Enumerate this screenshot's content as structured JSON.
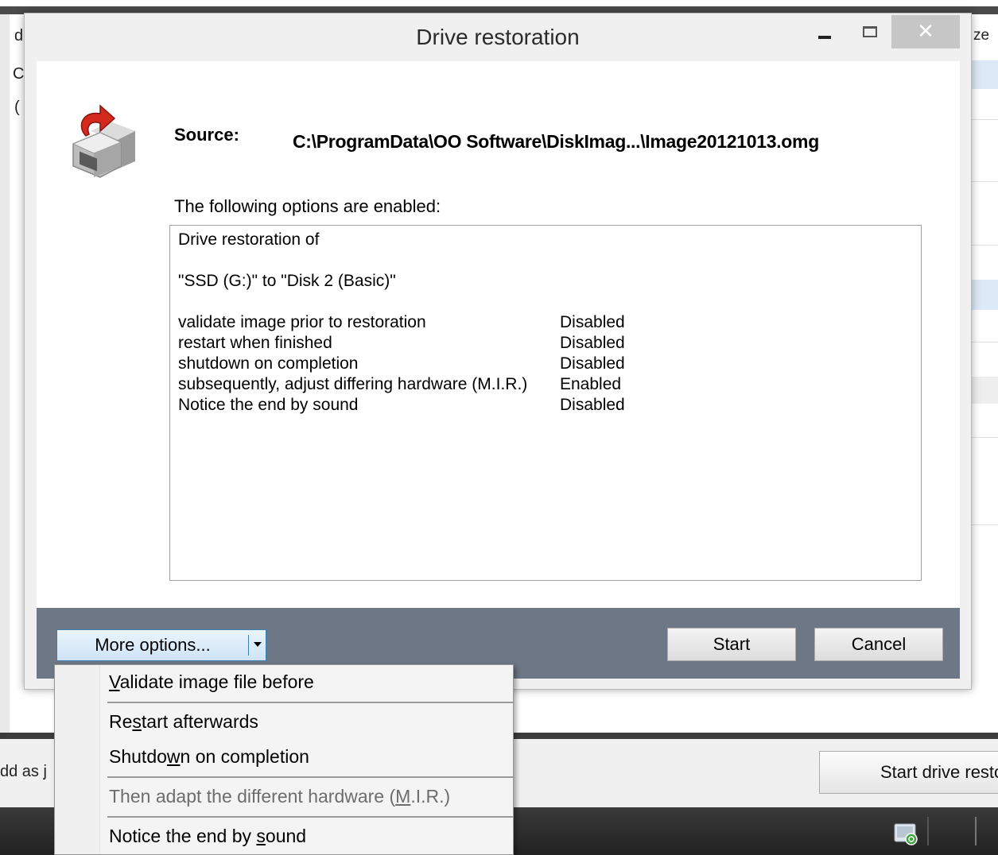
{
  "background": {
    "left_texts": [
      "d",
      "C",
      "(",
      "dd as j"
    ],
    "right_header": "ze",
    "start_button_label": "Start drive resto"
  },
  "dialog": {
    "title": "Drive restoration",
    "close_glyph": "✕",
    "source_label": "Source:",
    "source_path": "C:\\ProgramData\\OO Software\\DiskImag...\\Image20121013.omg",
    "options_heading": "The following options are enabled:",
    "summary": {
      "line1": "Drive restoration of",
      "line2": "\"SSD (G:)\" to \"Disk 2 (Basic)\"",
      "options": [
        {
          "name": "validate image prior to restoration",
          "status": "Disabled"
        },
        {
          "name": "restart when finished",
          "status": "Disabled"
        },
        {
          "name": "shutdown on completion",
          "status": "Disabled"
        },
        {
          "name": "subsequently, adjust differing hardware (M.I.R.)",
          "status": "Enabled"
        },
        {
          "name": "Notice the end by sound",
          "status": "Disabled"
        }
      ]
    },
    "more_options_label": "More options...",
    "start_label": "Start",
    "cancel_label": "Cancel"
  },
  "menu": {
    "items": [
      {
        "accel": "V",
        "rest": "alidate image file before",
        "enabled": true
      },
      {
        "pre": "Re",
        "accel": "s",
        "rest": "tart afterwards",
        "enabled": true
      },
      {
        "pre": "Shutdo",
        "accel": "w",
        "rest": "n on completion",
        "enabled": true
      },
      {
        "pre": "Then adapt the different hardware (",
        "accel": "M",
        "rest": ".I.R.)",
        "enabled": false
      },
      {
        "pre": "Notice the end by ",
        "accel": "s",
        "rest": "ound",
        "enabled": true
      }
    ]
  }
}
